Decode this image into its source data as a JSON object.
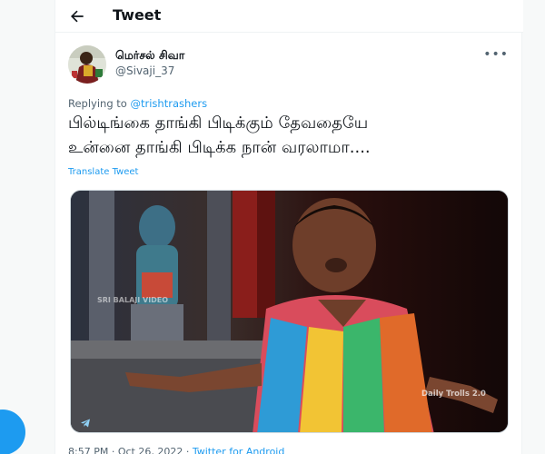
{
  "header": {
    "title": "Tweet",
    "back_icon": "arrow-left-icon"
  },
  "author": {
    "name": "மெர்சல் சிவா",
    "handle": "@Sivaji_37"
  },
  "reply": {
    "prefix": "Replying to ",
    "target": "@trishtrashers"
  },
  "tweet": {
    "line1": "பில்டிங்கை தாங்கி பிடிக்கும் தேவதையே",
    "line2": "உன்னை தாங்கி பிடிக்க நான் வரலாமா....",
    "translate_label": "Translate Tweet"
  },
  "media": {
    "watermark_top": "SRI BALAJI VIDEO",
    "watermark_bottom": "Daily Trolls 2.0",
    "telegram_icon": "telegram-icon"
  },
  "meta": {
    "time": "8:57 PM",
    "sep": " · ",
    "date": "Oct 26, 2022",
    "source": "Twitter for Android"
  },
  "colors": {
    "accent": "#1d9bf0",
    "secondary_text": "#536471",
    "border": "#cfd9de"
  }
}
